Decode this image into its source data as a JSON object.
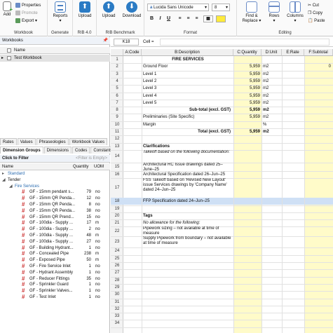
{
  "ribbon": {
    "workbook": {
      "add": "Add",
      "properties": "Properties",
      "promote": "Promote",
      "export": "Export",
      "label": "Workbook"
    },
    "generate": {
      "reports": "Reports",
      "label": "Generate"
    },
    "rib40": {
      "upload": "Upload",
      "label": "RIB 4.0"
    },
    "benchmark": {
      "upload": "Upload",
      "download": "Download",
      "label": "RIB Benchmark"
    },
    "format": {
      "font": "Lucida Sans Unicode",
      "size": "8",
      "bold": "B",
      "italic": "I",
      "underline": "U",
      "label": "Format"
    },
    "editing": {
      "find_replace": "Find & Replace",
      "rows": "Rows",
      "columns": "Columns",
      "cut": "Cut",
      "copy": "Copy",
      "paste": "Paste",
      "label": "Editing"
    }
  },
  "workbooks": {
    "title": "Workbooks",
    "col_name": "Name",
    "items": [
      "Test Workbook"
    ]
  },
  "lower_tabs_row1": [
    "Rates",
    "Values",
    "Phraseologies",
    "Workbook Values"
  ],
  "lower_tabs_row2": [
    "Dimension Groups",
    "Dimensions",
    "Codes",
    "Constants"
  ],
  "filter": {
    "label": "Click to Filter",
    "hint": "<Filter is Empty>"
  },
  "dim_columns": {
    "name": "Name",
    "quantity": "Quantity",
    "uom": "UOM"
  },
  "dim_tree": {
    "standard": "Standard",
    "tender": "Tender",
    "fire_services": "Fire Services"
  },
  "dim_items": [
    {
      "name": "GF - 15mm pendant s...",
      "qty": "79",
      "uom": "no"
    },
    {
      "name": "GF - 15mm QR Penda...",
      "qty": "12",
      "uom": "no"
    },
    {
      "name": "GF - 15mm QR Penda...",
      "qty": "8",
      "uom": "no"
    },
    {
      "name": "GF - 15mm QR Penda...",
      "qty": "38",
      "uom": "no"
    },
    {
      "name": "GF - 15mm QR Prend...",
      "qty": "15",
      "uom": "no"
    },
    {
      "name": "GF - 100dia - Supply ...",
      "qty": "17",
      "uom": "m"
    },
    {
      "name": "GF - 100dia - Supply ...",
      "qty": "2",
      "uom": "no"
    },
    {
      "name": "GF - 100dia - Supply ...",
      "qty": "48",
      "uom": "m"
    },
    {
      "name": "GF - 100dia - Supply ...",
      "qty": "27",
      "uom": "no"
    },
    {
      "name": "GF - Building Hydrant...",
      "qty": "1",
      "uom": "no"
    },
    {
      "name": "GF - Concealed Pipe",
      "qty": "238",
      "uom": "m"
    },
    {
      "name": "GF - Exposed Pipe",
      "qty": "50",
      "uom": "m"
    },
    {
      "name": "GF - Fire Service Inlet",
      "qty": "1",
      "uom": "no"
    },
    {
      "name": "GF - Hydrant Assembly",
      "qty": "1",
      "uom": "no"
    },
    {
      "name": "GF - Reducer Fittings",
      "qty": "35",
      "uom": "no"
    },
    {
      "name": "GF - Sprinkler Guard",
      "qty": "1",
      "uom": "no"
    },
    {
      "name": "GF - Sprinkler Valves...",
      "qty": "1",
      "uom": "no"
    },
    {
      "name": "GF - Test Inlet",
      "qty": "1",
      "uom": "no"
    }
  ],
  "formula_bar": {
    "cell_ref": "K18",
    "cell_label": "Cell ="
  },
  "sheet_columns": [
    "A:Code",
    "B:Description",
    "C:Quantity",
    "D:Unit",
    "E:Rate",
    "F:Subtotal"
  ],
  "rows": [
    {
      "n": "1",
      "b": "FIRE SERVICES",
      "c": "",
      "d": "",
      "f": ""
    },
    {
      "n": "2",
      "b": "Ground Floor",
      "c": "5,959",
      "d": "m2",
      "f": "0"
    },
    {
      "n": "3",
      "b": "Level 1",
      "c": "5,959",
      "d": "m2",
      "f": ""
    },
    {
      "n": "4",
      "b": "Level 2",
      "c": "5,959",
      "d": "m2",
      "f": ""
    },
    {
      "n": "5",
      "b": "Level 3",
      "c": "5,959",
      "d": "m2",
      "f": ""
    },
    {
      "n": "6",
      "b": "Level 4",
      "c": "5,959",
      "d": "m2",
      "f": ""
    },
    {
      "n": "7",
      "b": "Level 5",
      "c": "5,959",
      "d": "m2",
      "f": ""
    },
    {
      "n": "8",
      "b": "Sub-total (excl. GST)",
      "c": "5,959",
      "d": "m2",
      "f": ""
    },
    {
      "n": "9",
      "b": "Preliminaries (Site Specific)",
      "c": "5,959",
      "d": "m2",
      "f": ""
    },
    {
      "n": "10",
      "b": "Margin",
      "c": "",
      "d": "%",
      "f": ""
    },
    {
      "n": "11",
      "b": "Total (excl. GST)",
      "c": "5,959",
      "d": "m2",
      "f": ""
    },
    {
      "n": "12",
      "b": "",
      "c": "",
      "d": "",
      "f": ""
    },
    {
      "n": "13",
      "b": "Clarifications",
      "c": "",
      "d": "",
      "f": ""
    },
    {
      "n": "14",
      "b": "Takeoff based on the following documentation:",
      "c": "",
      "d": "",
      "f": ""
    },
    {
      "n": "15",
      "b": "Architectural RC Issue drawings dated 25–June–25",
      "c": "",
      "d": "",
      "f": ""
    },
    {
      "n": "16",
      "b": "Architectural Specification dated 26–Jun–25",
      "c": "",
      "d": "",
      "f": ""
    },
    {
      "n": "17",
      "b": "FSS Takeoff based on 'Revised New Layout' issue Services drawings by 'Company Name' dated 24–Jun–25",
      "c": "",
      "d": "",
      "f": ""
    },
    {
      "n": "18",
      "b": "FFP Specification dated 24–Jun–25",
      "c": "",
      "d": "",
      "f": ""
    },
    {
      "n": "19",
      "b": "",
      "c": "",
      "d": "",
      "f": ""
    },
    {
      "n": "20",
      "b": "Tags",
      "c": "",
      "d": "",
      "f": ""
    },
    {
      "n": "21",
      "b": "No allowance for the following:",
      "c": "",
      "d": "",
      "f": ""
    },
    {
      "n": "22",
      "b": "Pipework sizing – not available at time of measure",
      "c": "",
      "d": "",
      "f": ""
    },
    {
      "n": "23",
      "b": "Supply Pipework from boundary – not available at time of measure",
      "c": "",
      "d": "",
      "f": ""
    },
    {
      "n": "24",
      "b": "",
      "c": "",
      "d": "",
      "f": ""
    },
    {
      "n": "25",
      "b": "",
      "c": "",
      "d": "",
      "f": ""
    },
    {
      "n": "26",
      "b": "",
      "c": "",
      "d": "",
      "f": ""
    },
    {
      "n": "27",
      "b": "",
      "c": "",
      "d": "",
      "f": ""
    },
    {
      "n": "28",
      "b": "",
      "c": "",
      "d": "",
      "f": ""
    },
    {
      "n": "29",
      "b": "",
      "c": "",
      "d": "",
      "f": ""
    },
    {
      "n": "30",
      "b": "",
      "c": "",
      "d": "",
      "f": ""
    },
    {
      "n": "31",
      "b": "",
      "c": "",
      "d": "",
      "f": ""
    },
    {
      "n": "32",
      "b": "",
      "c": "",
      "d": "",
      "f": ""
    },
    {
      "n": "33",
      "b": "",
      "c": "",
      "d": "",
      "f": ""
    },
    {
      "n": "34",
      "b": "",
      "c": "",
      "d": "",
      "f": ""
    }
  ],
  "colors": {
    "accent": "#2b6cb0",
    "yellow_column": "#fffbc9",
    "hash": "#c33333",
    "selected_row": "#cfe0f5"
  }
}
